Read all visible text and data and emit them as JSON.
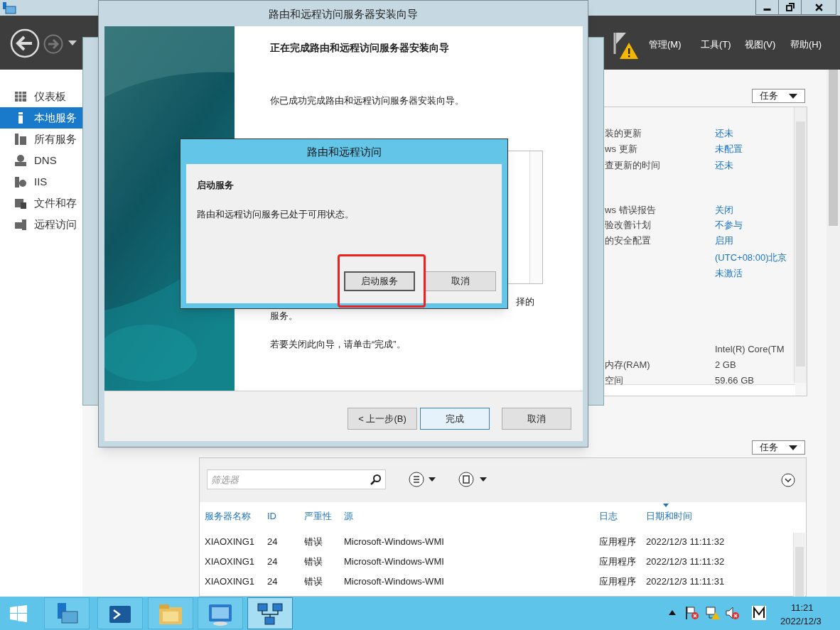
{
  "server_manager": {
    "header": {
      "menus": [
        "管理(M)",
        "工具(T)",
        "视图(V)",
        "帮助(H)"
      ]
    },
    "nav": {
      "items": [
        {
          "label": "仪表板",
          "selected": false
        },
        {
          "label": "本地服务",
          "selected": true
        },
        {
          "label": "所有服务",
          "selected": false
        },
        {
          "label": "DNS",
          "selected": false
        },
        {
          "label": "IIS",
          "selected": false
        },
        {
          "label": "文件和存",
          "selected": false
        },
        {
          "label": "远程访问",
          "selected": false
        }
      ]
    },
    "properties": {
      "tasks_button": "任务",
      "rows": [
        {
          "label": "装的更新",
          "value": "还未"
        },
        {
          "label": "ws 更新",
          "value": "未配置"
        },
        {
          "label": "查更新的时间",
          "value": "还未"
        },
        {
          "label": "ws 错误报告",
          "value": "关闭"
        },
        {
          "label": "验改善计划",
          "value": "不参与"
        },
        {
          "label": "的安全配置",
          "value": "启用"
        },
        {
          "value": "(UTC+08:00)北京"
        },
        {
          "value": "未激活"
        },
        {
          "value": "Intel(R) Core(TM"
        },
        {
          "label": "内存(RAM)",
          "value": "2 GB"
        },
        {
          "label": "空间",
          "value": "59.66 GB"
        }
      ]
    },
    "events": {
      "tasks_button": "任务",
      "filter": {
        "placeholder": "筛选器"
      },
      "columns": [
        "服务器名称",
        "ID",
        "严重性",
        "源",
        "日志",
        "日期和时间"
      ],
      "rows": [
        [
          "XIAOXING1",
          "24",
          "错误",
          "Microsoft-Windows-WMI",
          "应用程序",
          "2022/12/3 11:11:32"
        ],
        [
          "XIAOXING1",
          "24",
          "错误",
          "Microsoft-Windows-WMI",
          "应用程序",
          "2022/12/3 11:11:32"
        ],
        [
          "XIAOXING1",
          "24",
          "错误",
          "Microsoft-Windows-WMI",
          "应用程序",
          "2022/12/3 11:11:31"
        ]
      ]
    }
  },
  "wizard": {
    "title": "路由和远程访问服务器安装向导",
    "heading": "正在完成路由和远程访问服务器安装向导",
    "intro": "你已成功完成路由和远程访问服务器安装向导。",
    "note_end": "择的",
    "note_tail": "服务。",
    "close_hint": "若要关闭此向导，请单击“完成”。",
    "buttons": [
      {
        "label": "< 上一步(B)",
        "default": false
      },
      {
        "label": "完成",
        "default": true
      },
      {
        "label": "取消",
        "default": false
      }
    ]
  },
  "dialog": {
    "title": "路由和远程访问",
    "heading": "启动服务",
    "message": "路由和远程访问服务已处于可用状态。",
    "buttons": [
      {
        "label": "启动服务",
        "default": true,
        "highlighted": true
      },
      {
        "label": "取消",
        "default": false,
        "highlighted": false
      }
    ]
  },
  "taskbar": {
    "apps": [
      {
        "selected": false
      },
      {
        "selected": false
      },
      {
        "selected": false
      },
      {
        "selected": false
      },
      {
        "selected": true
      }
    ],
    "time": "11:21",
    "date": "2022/12/3"
  }
}
